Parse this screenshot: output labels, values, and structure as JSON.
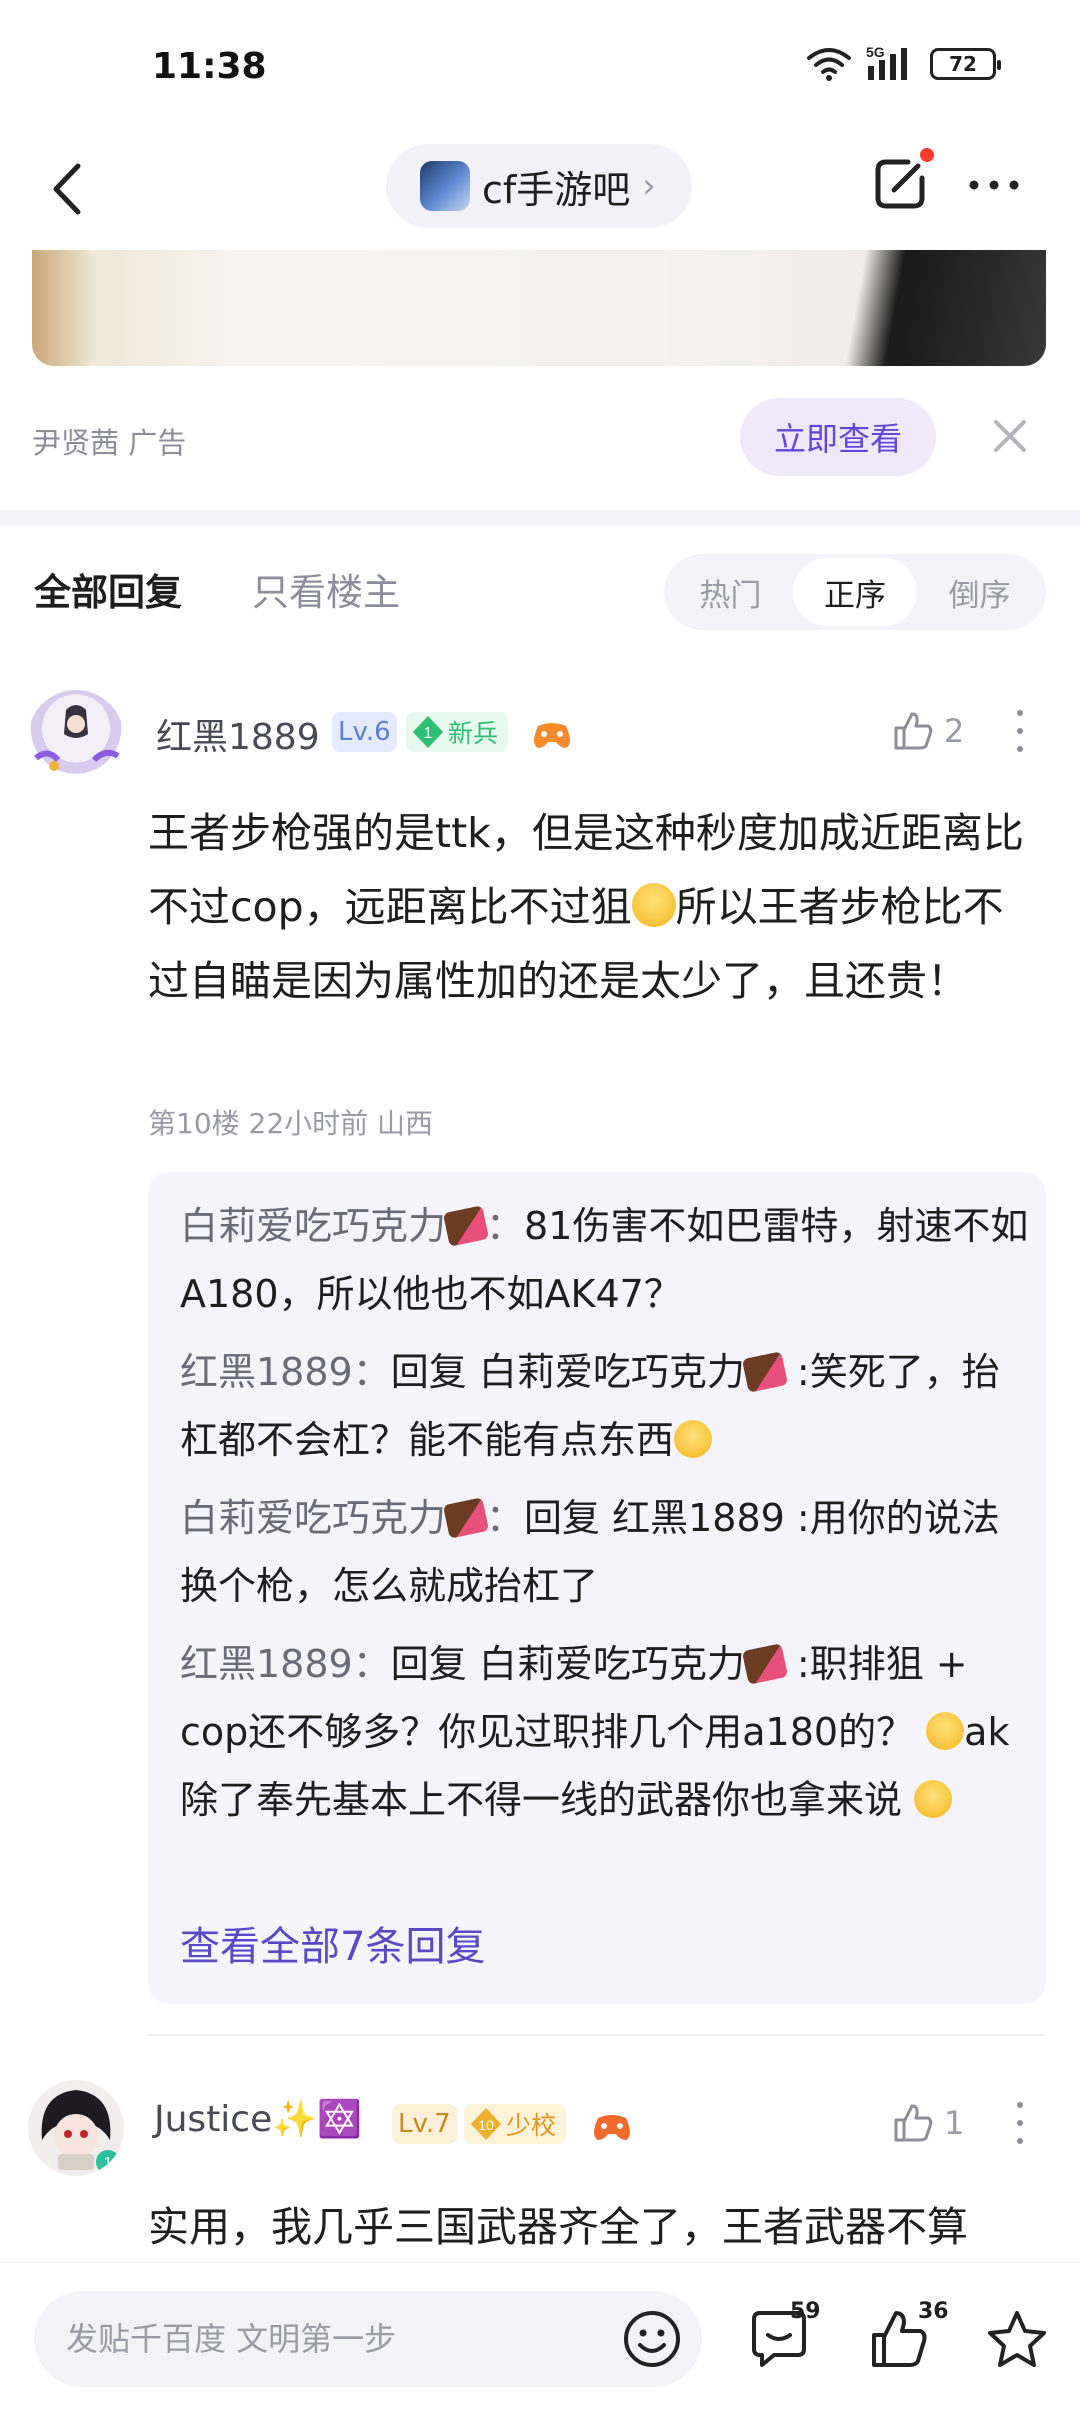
{
  "status_bar": {
    "time": "11:38",
    "network": "5G",
    "battery": "72"
  },
  "header": {
    "forum_name": "cf手游吧",
    "chevron": "›"
  },
  "ad": {
    "source": "尹贤茜  广告",
    "cta_label": "立即查看"
  },
  "tabs": {
    "all_replies": "全部回复",
    "op_only": "只看楼主"
  },
  "sort": {
    "options": [
      "热门",
      "正序",
      "倒序"
    ],
    "selected": "正序"
  },
  "comments": [
    {
      "username": "红黑1889",
      "level": "Lv.6",
      "title_num": "1",
      "title": "新兵",
      "likes": "2",
      "text_1": "王者步枪强的是ttk，但是这种秒度加成近距离比不过cop，远距离比不过狙",
      "text_2": "所以王者步枪比不过自瞄是因为属性加的还是太少了，且还贵！",
      "meta": "第10楼   22小时前   山西"
    },
    {
      "username": "Justice✨🔯",
      "level": "Lv.7",
      "title_num": "10",
      "title": "少校",
      "likes": "1",
      "text_1": "实用，我几乎三国武器齐全了，王者武器不算"
    }
  ],
  "replies": [
    {
      "author": "白莉爱吃巧克力",
      "sep": "：",
      "text": "81伤害不如巴雷特，射速不如A180，所以他也不如AK47？"
    },
    {
      "author": "红黑1889",
      "sep": "：",
      "reply_word": "回复 ",
      "reply_to": "白莉爱吃巧克力",
      "text": " :笑死了，抬杠都不会杠？能不能有点东西"
    },
    {
      "author": "白莉爱吃巧克力",
      "sep": "：",
      "reply_word": "回复 ",
      "reply_to": "红黑1889",
      "text": " :用你的说法换个枪，怎么就成抬杠了"
    },
    {
      "author": "红黑1889",
      "sep": "：",
      "reply_word": "回复 ",
      "reply_to": "白莉爱吃巧克力",
      "text_1": " :职排狙 + cop还不够多？你见过职排几个用a180的？ ",
      "text_2": "ak除了奉先基本上不得一线的武器你也拿来说 "
    }
  ],
  "view_all_replies": "查看全部7条回复",
  "bottom_bar": {
    "compose_placeholder": "发贴千百度 文明第一步",
    "comment_count": "59",
    "like_count": "36"
  },
  "colors": {
    "accent": "#6246d9",
    "link": "#5b48c6",
    "red_dot": "#ff3b30"
  }
}
